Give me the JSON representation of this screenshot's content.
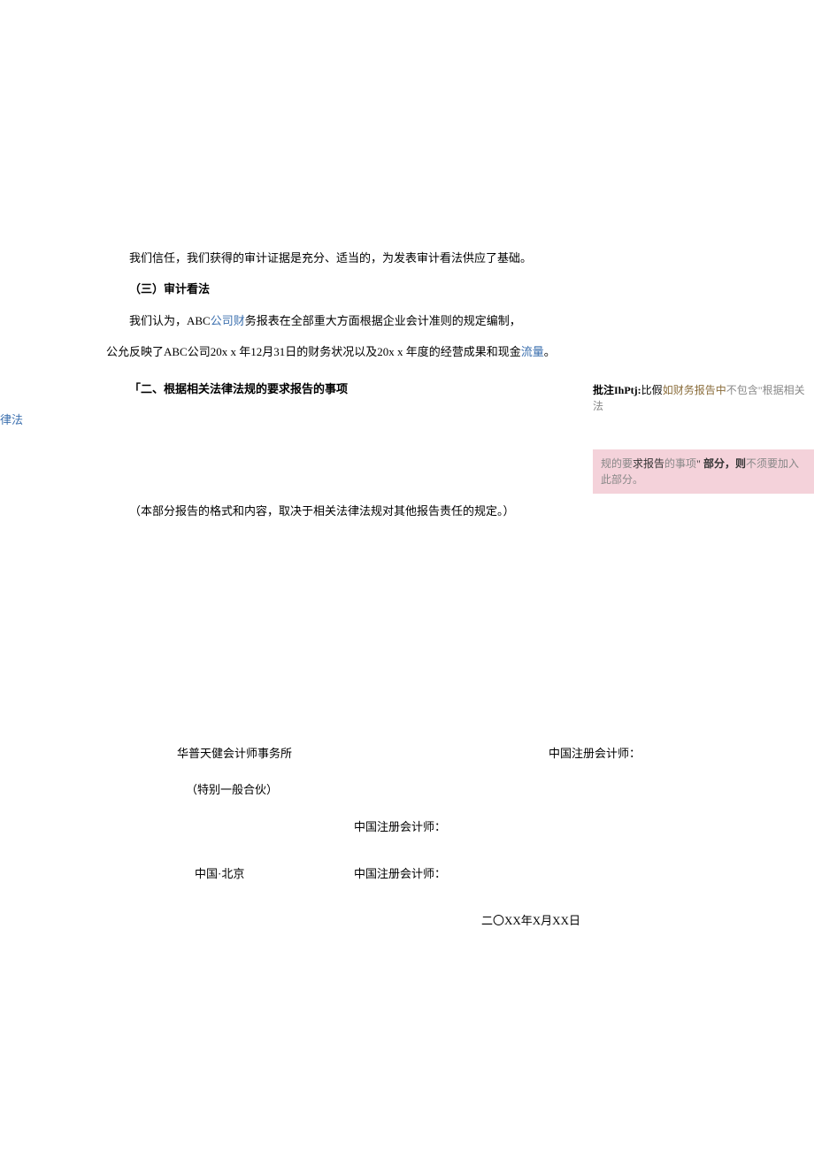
{
  "paragraphs": {
    "p1": "我们信任，我们获得的审计证据是充分、适当的，为发表审计看法供应了基础。",
    "heading3": "（三）审计看法",
    "p2_pre": "我们认为，ABC",
    "p2_link1": "公司财",
    "p2_post": "务报表在全部重大方面根据企业会计准则的规定编制，",
    "p3_pre": "公允反映了ABC公司20x",
    "p3_x1": " x",
    "p3_mid": " 年12月31日的财务状况以及20x",
    "p3_x2": " x",
    "p3_mid2": " 年度的经营成果和现金",
    "p3_link": "流量",
    "p3_end": "。",
    "heading2": "「二、根据相关法律法规的要求报告的事项",
    "hanging": "律法",
    "p4": "（本部分报告的格式和内容，取决于相关法律法规对其他报告责任的规定。）"
  },
  "signature": {
    "firm": "华普天健会计师事务所",
    "partnership": "（特别一般合伙）",
    "cpa_label": "中国注册会计师：",
    "cpa_label2": "中国注册会计师：",
    "cpa_label3": "中国注册会计师：",
    "location": "中国·北京",
    "date": "二〇XX年X月XX日"
  },
  "annotation": {
    "label_bold": "批注IhPtj:",
    "label_text1": "比假",
    "label_text2": "如财务报告中",
    "label_gray": "不包含\"根据相关法",
    "box_text1": "规的要",
    "box_text2": "求报告",
    "box_text3": "的事项",
    "box_quote": "\" ",
    "box_bold": "部分，则",
    "box_gray": "不须要加入此部分。"
  }
}
